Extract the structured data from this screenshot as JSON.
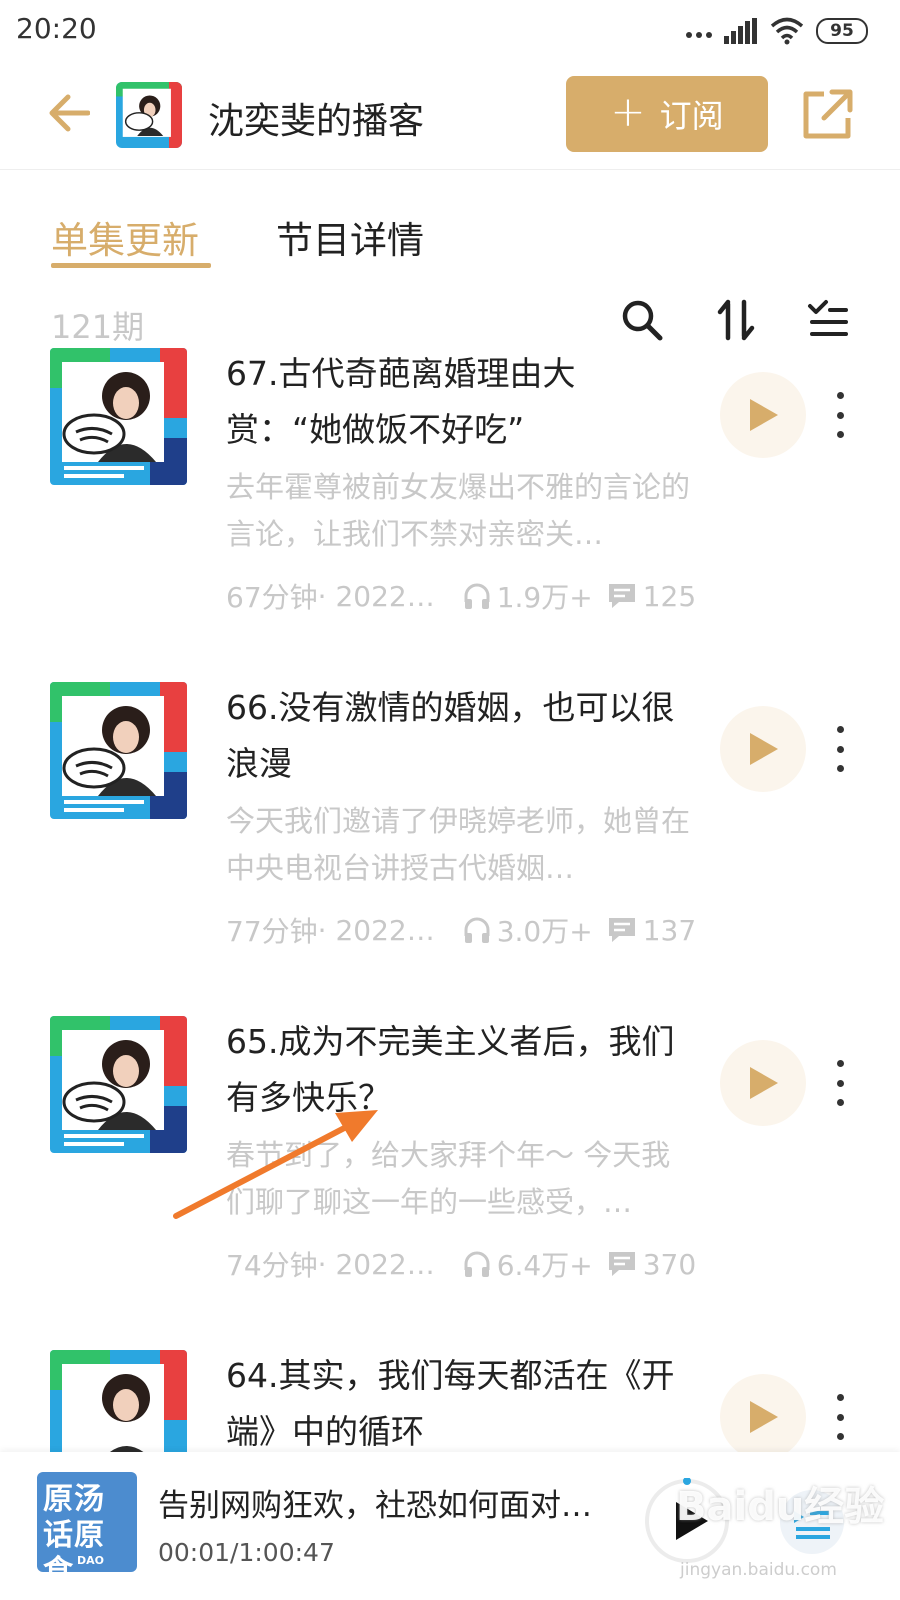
{
  "status_bar": {
    "time": "20:20",
    "battery": "95",
    "icons": [
      "signal-dots-icon",
      "cellular-signal-icon",
      "wifi-icon",
      "battery-icon"
    ]
  },
  "header": {
    "back_icon": "arrow-left-icon",
    "title": "沈奕斐的播客",
    "subscribe_plus": "+",
    "subscribe_label": "订阅",
    "share_icon": "share-external-icon",
    "accent_color": "#d7ad6b"
  },
  "tabs": [
    {
      "label": "单集更新",
      "active": true
    },
    {
      "label": "节目详情",
      "active": false
    }
  ],
  "toolbar": {
    "count": "121期",
    "icons": [
      "search-icon",
      "sort-icon",
      "multi-select-icon"
    ]
  },
  "episodes": [
    {
      "title": "67.古代奇葩离婚理由大赏：“她做饭不好吃”",
      "description": "去年霍尊被前女友爆出不雅的言论的言论，让我们不禁对亲密关…",
      "duration": "67分钟",
      "date": "· 2022…",
      "plays": "1.9万+",
      "comments": "125"
    },
    {
      "title": "66.没有激情的婚姻，也可以很浪漫",
      "description": "今天我们邀请了伊晓婷老师，她曾在中央电视台讲授古代婚姻…",
      "duration": "77分钟",
      "date": "· 2022…",
      "plays": "3.0万+",
      "comments": "137"
    },
    {
      "title": "65.成为不完美主义者后，我们有多快乐？",
      "description": "春节到了，给大家拜个年～ 今天我们聊了聊这一年的一些感受，…",
      "duration": "74分钟",
      "date": "· 2022…",
      "plays": "6.4万+",
      "comments": "370"
    },
    {
      "title": "64.其实，我们每天都活在《开端》中的循环",
      "description": "",
      "duration": "",
      "date": "",
      "plays": "",
      "comments": ""
    }
  ],
  "player": {
    "cover_text": "原汤话原食",
    "cover_sub": "DAO",
    "title": "告别网购狂欢，社恐如何面对…",
    "time": "00:01/1:00:47"
  },
  "watermark": {
    "text": "Baidu经验",
    "sub": "jingyan.baidu.com"
  }
}
